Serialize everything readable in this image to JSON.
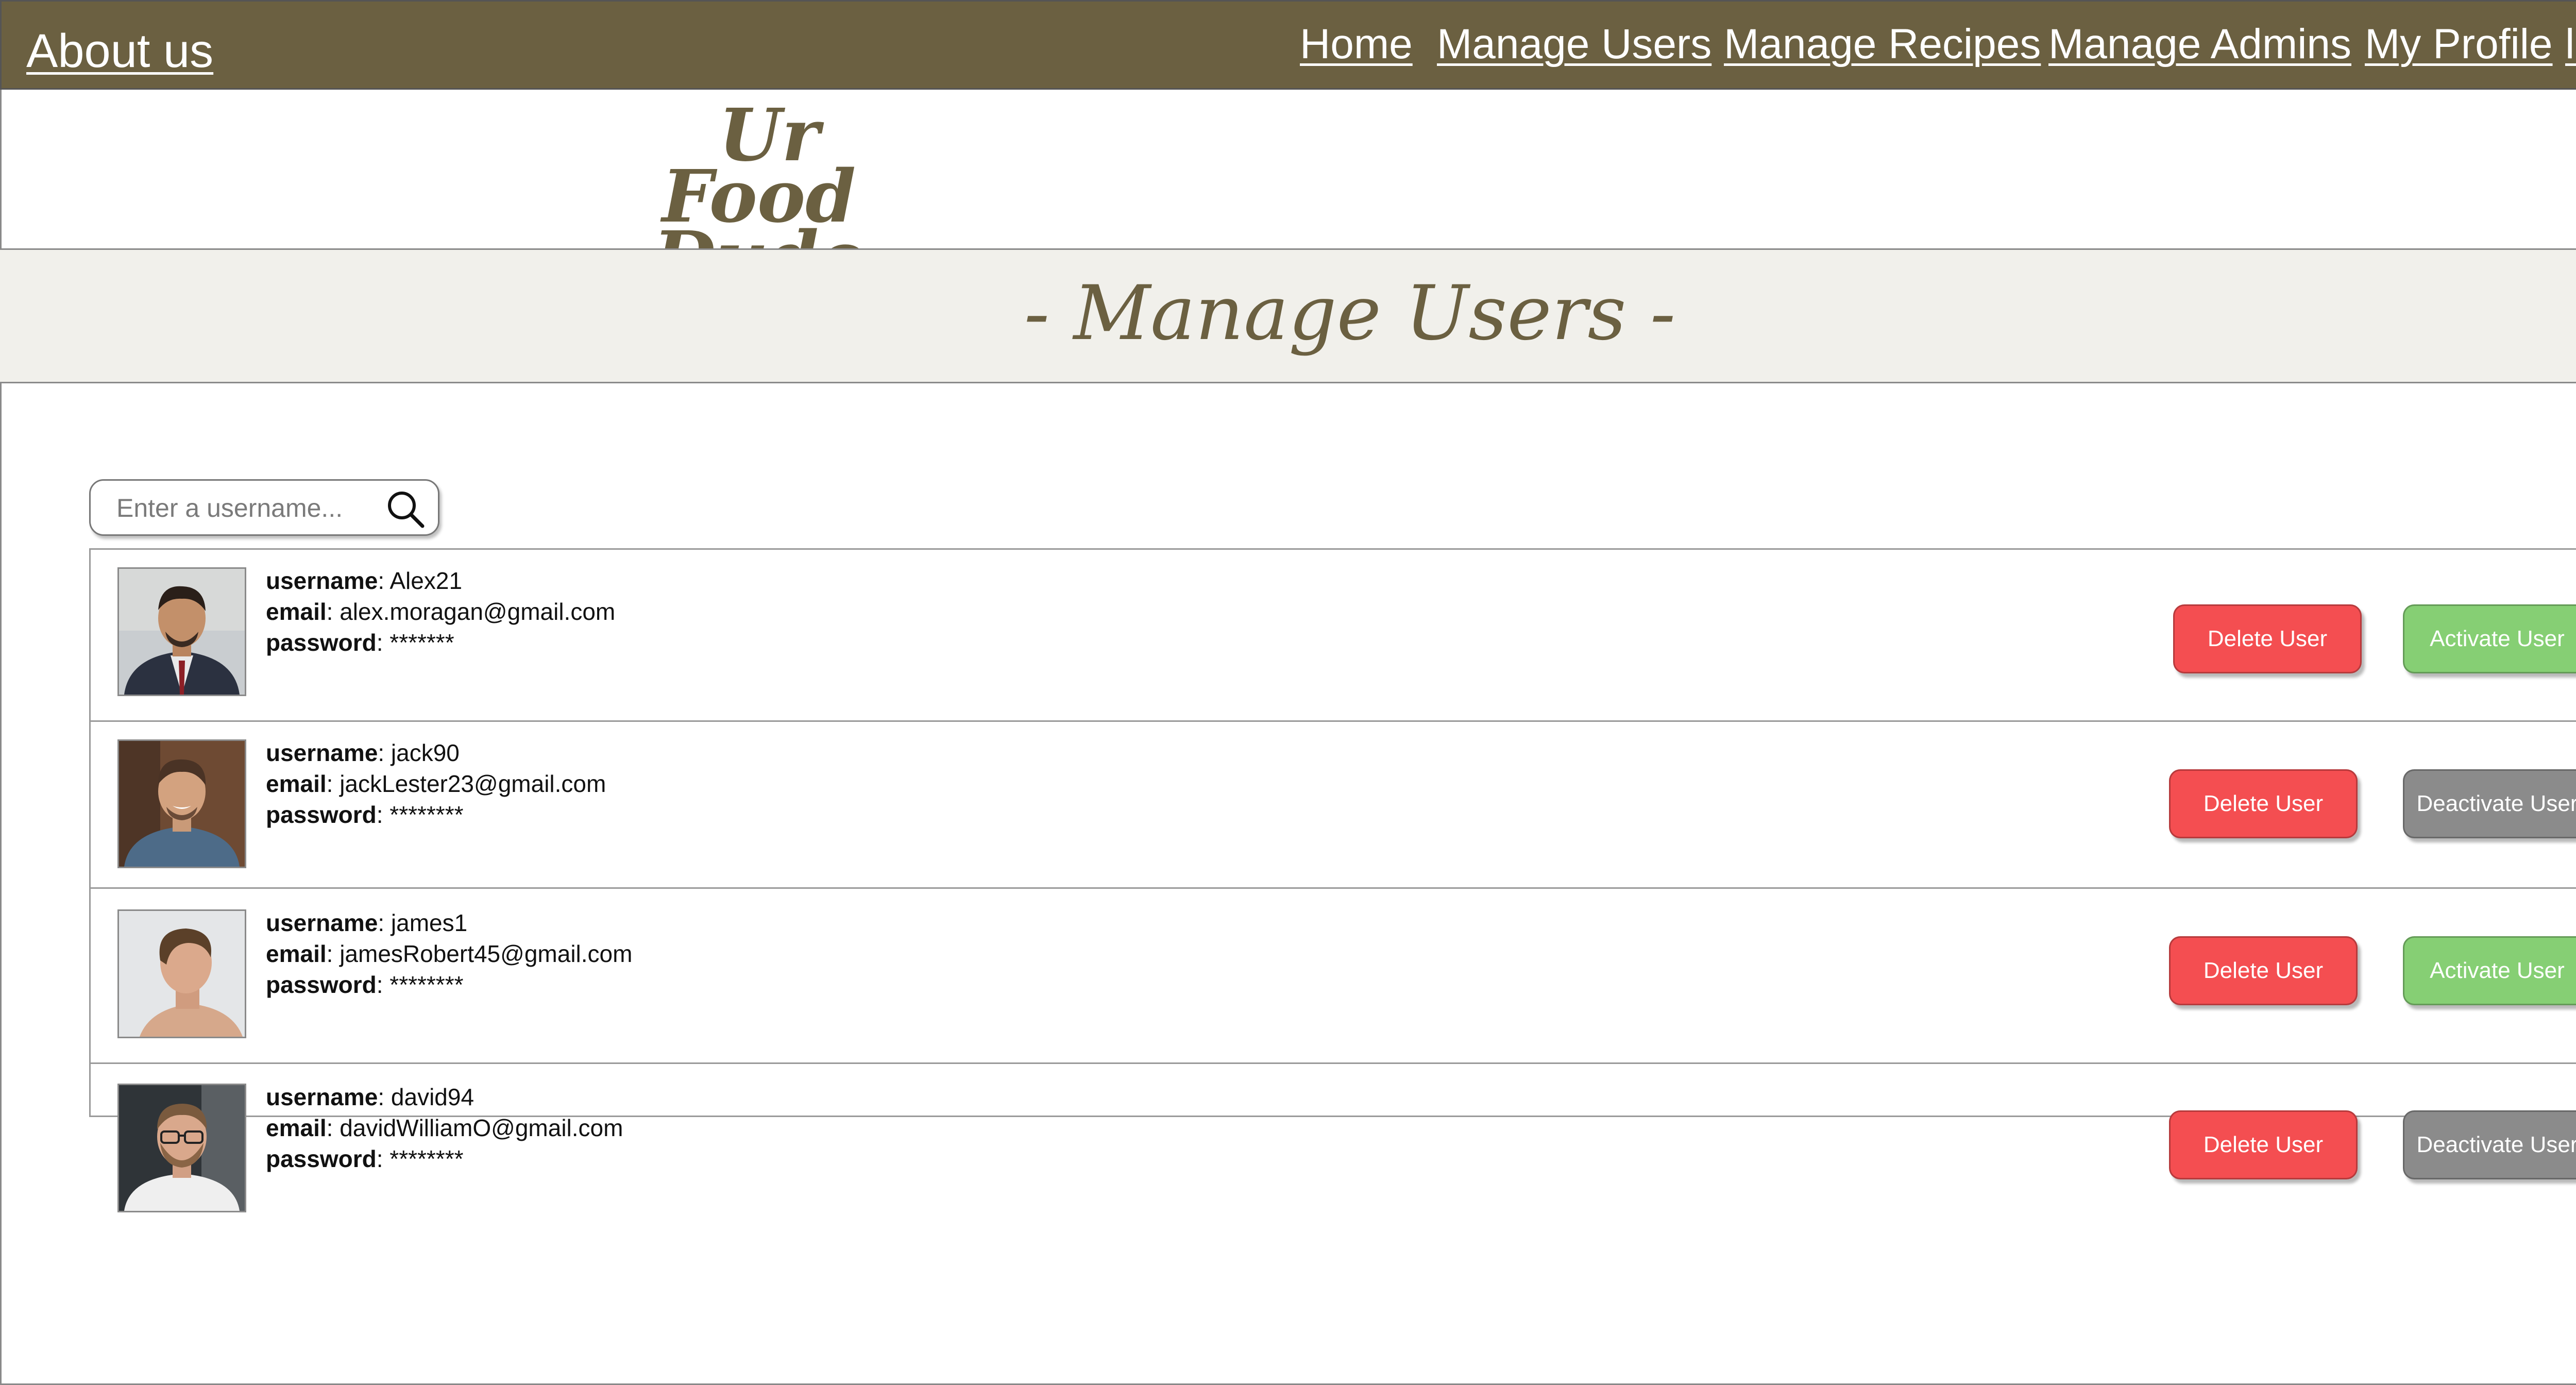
{
  "nav": {
    "about": "About us",
    "links": [
      "Home",
      "Manage Users",
      "Manage Recipes",
      "Manage Admins",
      "My Profile",
      "log out"
    ]
  },
  "logo": {
    "line1": "Ur",
    "line2": "Food Dude"
  },
  "page_title": "- Manage Users -",
  "search": {
    "placeholder": "Enter a username..."
  },
  "labels": {
    "username": "username",
    "email": "email",
    "password": "password"
  },
  "users": [
    {
      "username": "Alex21",
      "email": "alex.moragan@gmail.com",
      "password": "*******",
      "delete_label": "Delete User",
      "toggle_label": "Activate User"
    },
    {
      "username": "jack90",
      "email": "jackLester23@gmail.com",
      "password": "********",
      "delete_label": "Delete User",
      "toggle_label": "Deactivate User"
    },
    {
      "username": "james1",
      "email": "jamesRobert45@gmail.com",
      "password": "********",
      "delete_label": "Delete User",
      "toggle_label": "Activate User"
    },
    {
      "username": "david94",
      "email": "davidWilliamO@gmail.com",
      "password": "********",
      "delete_label": "Delete User",
      "toggle_label": "Deactivate User"
    }
  ],
  "colors": {
    "brand": "#6b6041",
    "title_band": "#f1f0eb",
    "delete": "#f44e51",
    "activate": "#86cf74",
    "deactivate": "#8b8b8b"
  }
}
